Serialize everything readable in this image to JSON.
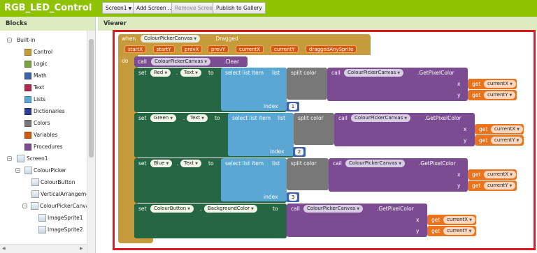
{
  "app": {
    "title": "RGB_LED_Control"
  },
  "toolbar": {
    "screen_select": "Screen1",
    "add_screen": "Add Screen ...",
    "remove_screen": "Remove Screen",
    "publish": "Publish to Gallery"
  },
  "blocks_panel": {
    "title": "Blocks",
    "builtin": "Built-in",
    "categories": [
      {
        "label": "Control",
        "color": "#c69b3c"
      },
      {
        "label": "Logic",
        "color": "#7aa33f"
      },
      {
        "label": "Math",
        "color": "#3e63ad"
      },
      {
        "label": "Text",
        "color": "#b3284e"
      },
      {
        "label": "Lists",
        "color": "#5aa7d4"
      },
      {
        "label": "Dictionaries",
        "color": "#2d3c93"
      },
      {
        "label": "Colors",
        "color": "#787878"
      },
      {
        "label": "Variables",
        "color": "#d15b12"
      },
      {
        "label": "Procedures",
        "color": "#7c4c93"
      }
    ],
    "components": [
      "Screen1",
      "ColourPicker",
      "ColourButton",
      "VerticalArrangemer",
      "ColourPickerCanvas",
      "ImageSprite1",
      "ImageSprite2"
    ]
  },
  "viewer": {
    "title": "Viewer",
    "event": {
      "when": "when",
      "component": "ColourPickerCanvas",
      "event_name": ".Dragged",
      "params": [
        "startX",
        "startY",
        "prevX",
        "prevY",
        "currentX",
        "currentY",
        "draggedAnySprite"
      ],
      "do": "do",
      "clear_call": "call",
      "clear_component": "ColourPickerCanvas",
      "clear_method": ".Clear"
    },
    "set_blocks": [
      {
        "set": "set",
        "component": "Red",
        "dot": ".",
        "property": "Text",
        "to": "to",
        "select": "select list item",
        "list": "list",
        "split": "split color",
        "call": "call",
        "call_component": "ColourPickerCanvas",
        "method": ".GetPixelColor",
        "x": "x",
        "y": "y",
        "get": "get",
        "var_x": "currentX",
        "var_y": "currentY",
        "index_label": "index",
        "index": "1"
      },
      {
        "set": "set",
        "component": "Green",
        "dot": ".",
        "property": "Text",
        "to": "to",
        "select": "select list item",
        "list": "list",
        "split": "split color",
        "call": "call",
        "call_component": "ColourPickerCanvas",
        "method": ".GetPixelColor",
        "x": "x",
        "y": "y",
        "get": "get",
        "var_x": "currentX",
        "var_y": "currentY",
        "index_label": "index",
        "index": "2"
      },
      {
        "set": "set",
        "component": "Blue",
        "dot": ".",
        "property": "Text",
        "to": "to",
        "select": "select list item",
        "list": "list",
        "split": "split color",
        "call": "call",
        "call_component": "ColourPickerCanvas",
        "method": ".GetPixelColor",
        "x": "x",
        "y": "y",
        "get": "get",
        "var_x": "currentX",
        "var_y": "currentY",
        "index_label": "index",
        "index": "3"
      }
    ],
    "last_set": {
      "set": "set",
      "component": "ColourButton",
      "dot": ".",
      "property": "BackgroundColor",
      "to": "to",
      "call": "call",
      "call_component": "ColourPickerCanvas",
      "method": ".GetPixelColor",
      "x": "x",
      "y": "y",
      "get": "get",
      "var_x": "currentX",
      "var_y": "currentY"
    }
  },
  "colors": {
    "topbar": "#8fc202",
    "highlight": "#e2171f",
    "control": "#c69b3c",
    "component_setter": "#266643",
    "component_method": "#7c4c93",
    "lists": "#5aa7d4",
    "colors": "#787878",
    "math": "#3e63ad",
    "variables": "#e9741d"
  }
}
